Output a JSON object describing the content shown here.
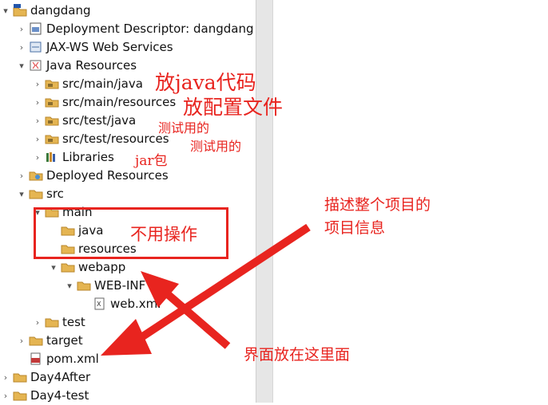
{
  "tree": {
    "items": [
      {
        "label": "dangdang",
        "icon": "maven-project-icon",
        "chev": "▾"
      },
      {
        "label": "Deployment Descriptor: dangdang",
        "icon": "descriptor-icon",
        "chev": "›"
      },
      {
        "label": "JAX-WS Web Services",
        "icon": "webservice-icon",
        "chev": "›"
      },
      {
        "label": "Java Resources",
        "icon": "java-resources-icon",
        "chev": "▾"
      },
      {
        "label": "src/main/java",
        "icon": "source-folder-icon",
        "chev": "›"
      },
      {
        "label": "src/main/resources",
        "icon": "source-folder-icon",
        "chev": "›"
      },
      {
        "label": "src/test/java",
        "icon": "source-folder-icon",
        "chev": "›"
      },
      {
        "label": "src/test/resources",
        "icon": "source-folder-icon",
        "chev": "›"
      },
      {
        "label": "Libraries",
        "icon": "library-icon",
        "chev": "›"
      },
      {
        "label": "Deployed Resources",
        "icon": "deployed-icon",
        "chev": "›"
      },
      {
        "label": "src",
        "icon": "folder-icon",
        "chev": "▾"
      },
      {
        "label": "main",
        "icon": "folder-icon",
        "chev": "▾"
      },
      {
        "label": "java",
        "icon": "folder-icon",
        "chev": ""
      },
      {
        "label": "resources",
        "icon": "folder-icon",
        "chev": ""
      },
      {
        "label": "webapp",
        "icon": "folder-icon",
        "chev": "▾"
      },
      {
        "label": "WEB-INF",
        "icon": "folder-icon",
        "chev": "▾"
      },
      {
        "label": "web.xml",
        "icon": "xml-file-icon",
        "chev": ""
      },
      {
        "label": "test",
        "icon": "folder-icon",
        "chev": "›"
      },
      {
        "label": "target",
        "icon": "folder-icon",
        "chev": "›"
      },
      {
        "label": "pom.xml",
        "icon": "pom-file-icon",
        "chev": ""
      },
      {
        "label": "Day4After",
        "icon": "project-icon",
        "chev": "›"
      },
      {
        "label": "Day4-test",
        "icon": "project-icon",
        "chev": "›"
      }
    ]
  },
  "annotations": {
    "java_code": "放java代码",
    "config_files": "放配置文件",
    "test_use_1": "测试用的",
    "test_use_2": "测试用的",
    "jar_pkg": "jar包",
    "no_op": "不用操作",
    "describe_1": "描述整个项目的",
    "describe_2": "项目信息",
    "ui_here": "界面放在这里面"
  },
  "colors": {
    "annotation": "#e8241f",
    "folder": "#e5b552",
    "separator": "#e6e6e6"
  }
}
